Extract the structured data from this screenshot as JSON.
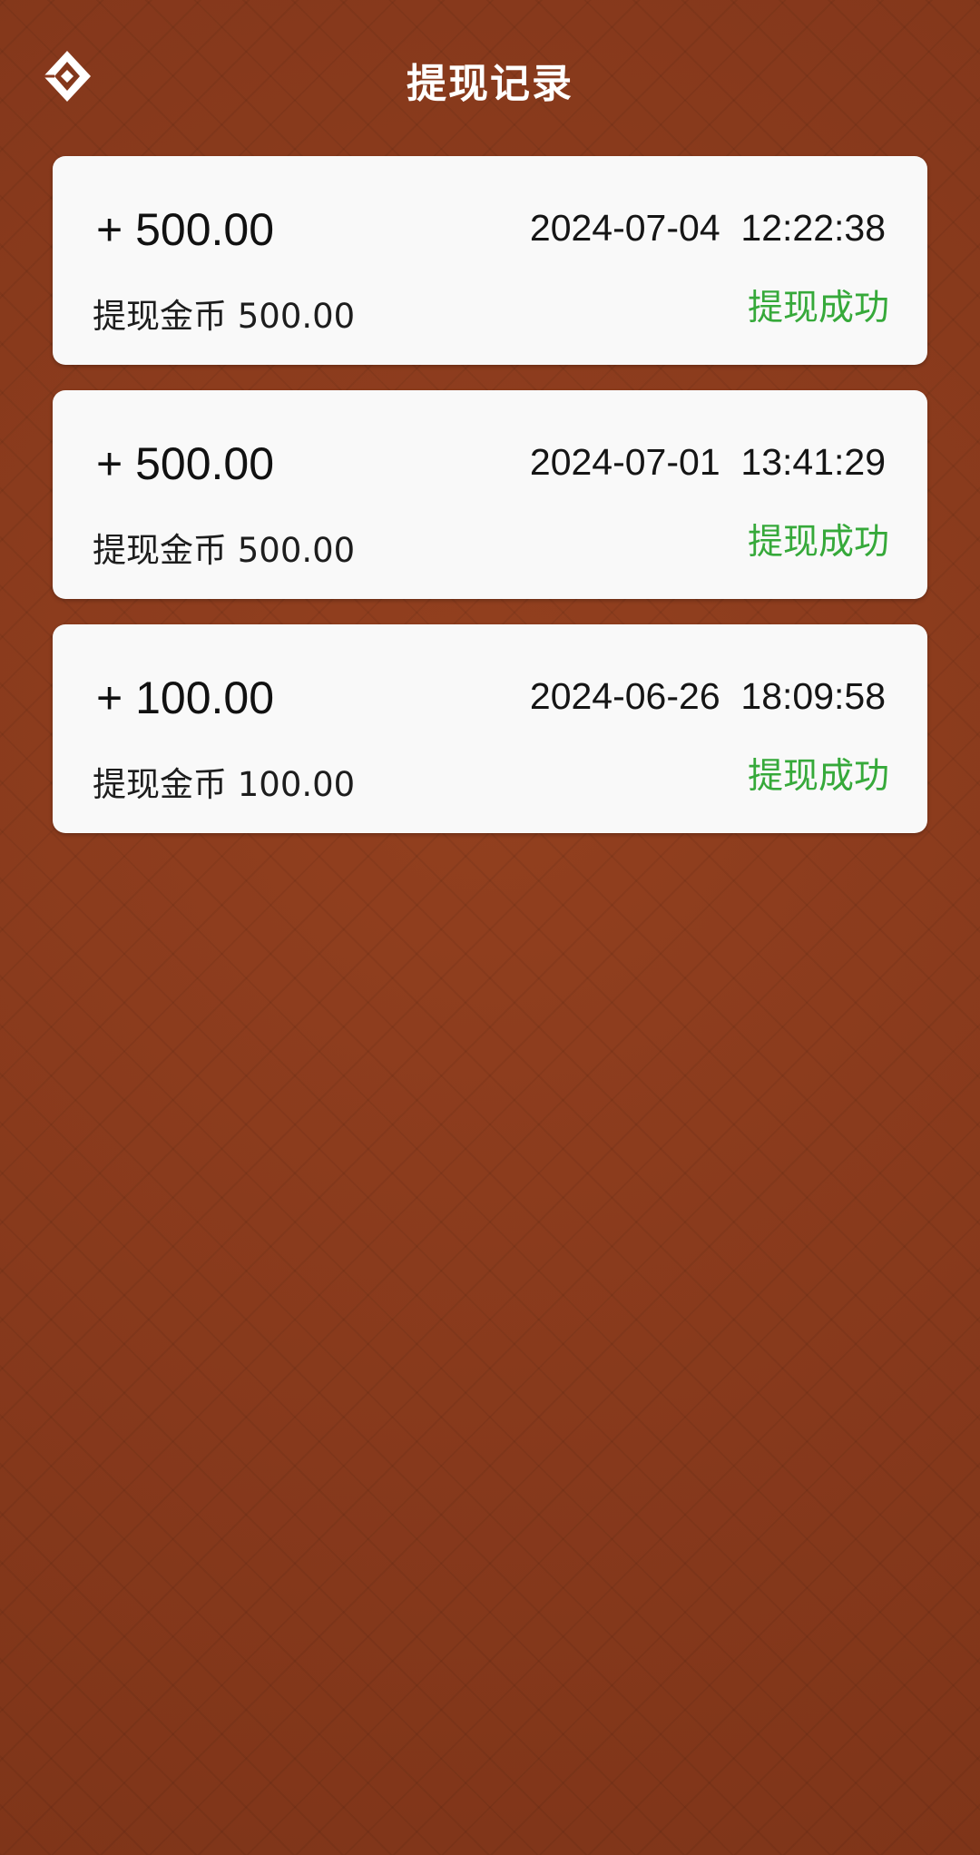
{
  "header": {
    "title": "提现记录",
    "back_icon": "diamond-back-icon"
  },
  "colors": {
    "background": "#8a3a1e",
    "card": "#f9f9f9",
    "status_success": "#36a93a",
    "title_text": "#ffffff"
  },
  "records": [
    {
      "amount": "+ 500.00",
      "datetime": "2024-07-04  12:22:38",
      "description": "提现金币 500.00",
      "status": "提现成功"
    },
    {
      "amount": "+ 500.00",
      "datetime": "2024-07-01  13:41:29",
      "description": "提现金币 500.00",
      "status": "提现成功"
    },
    {
      "amount": "+ 100.00",
      "datetime": "2024-06-26  18:09:58",
      "description": "提现金币 100.00",
      "status": "提现成功"
    }
  ]
}
